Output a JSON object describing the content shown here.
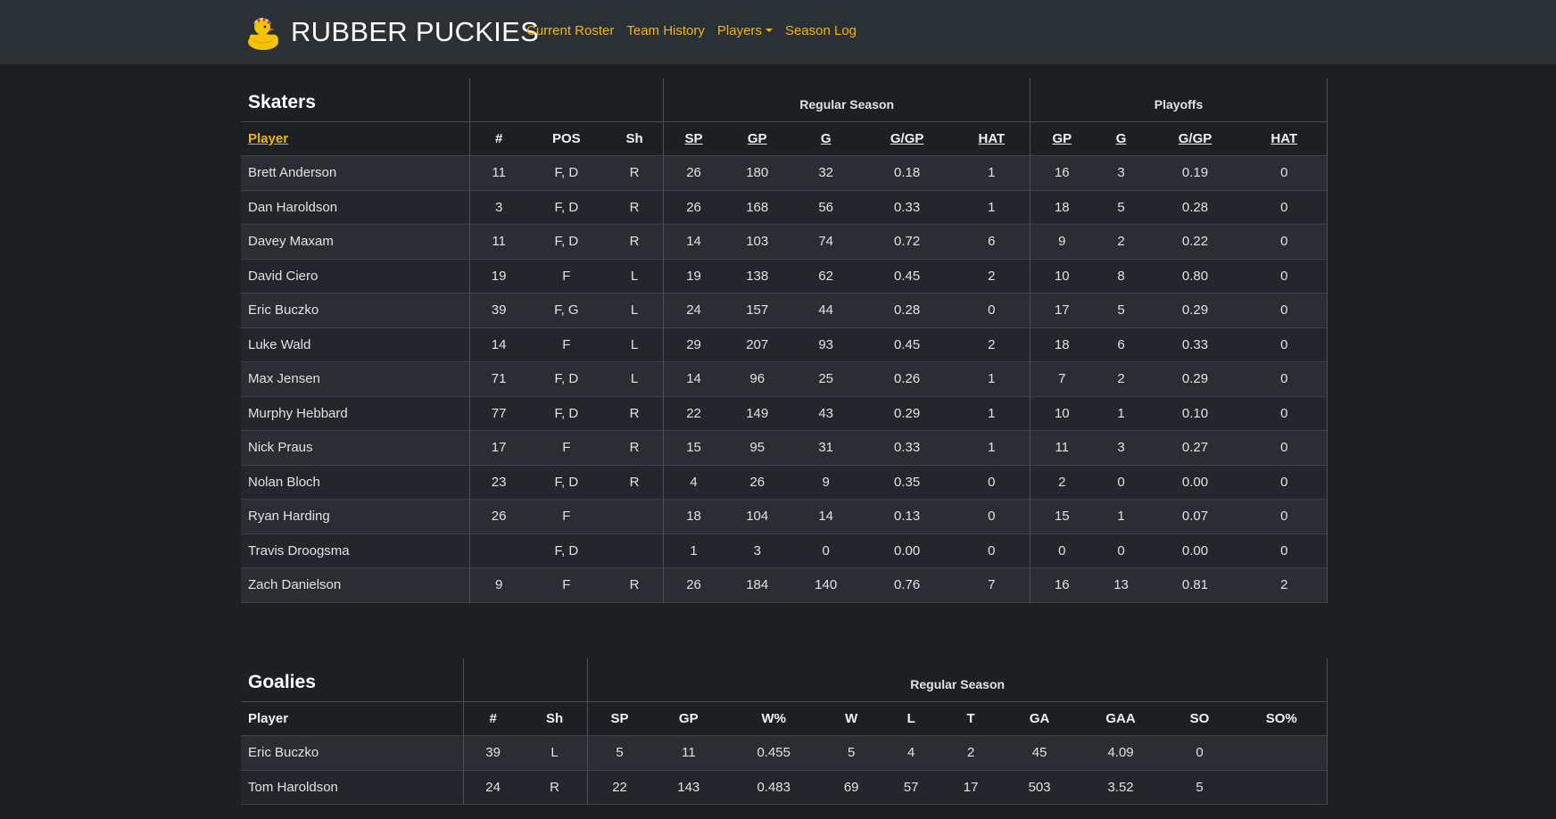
{
  "nav": {
    "brand": "RUBBER PUCKIES",
    "links": [
      "Current Roster",
      "Team History",
      "Players",
      "Season Log"
    ]
  },
  "skaters": {
    "title": "Skaters",
    "group_regular": "Regular Season",
    "group_playoffs": "Playoffs",
    "headers": [
      "Player",
      "#",
      "POS",
      "Sh",
      "SP",
      "GP",
      "G",
      "G/GP",
      "HAT",
      "GP",
      "G",
      "G/GP",
      "HAT"
    ],
    "rows": [
      [
        "Brett Anderson",
        "11",
        "F, D",
        "R",
        "26",
        "180",
        "32",
        "0.18",
        "1",
        "16",
        "3",
        "0.19",
        "0"
      ],
      [
        "Dan Haroldson",
        "3",
        "F, D",
        "R",
        "26",
        "168",
        "56",
        "0.33",
        "1",
        "18",
        "5",
        "0.28",
        "0"
      ],
      [
        "Davey Maxam",
        "11",
        "F, D",
        "R",
        "14",
        "103",
        "74",
        "0.72",
        "6",
        "9",
        "2",
        "0.22",
        "0"
      ],
      [
        "David Ciero",
        "19",
        "F",
        "L",
        "19",
        "138",
        "62",
        "0.45",
        "2",
        "10",
        "8",
        "0.80",
        "0"
      ],
      [
        "Eric Buczko",
        "39",
        "F, G",
        "L",
        "24",
        "157",
        "44",
        "0.28",
        "0",
        "17",
        "5",
        "0.29",
        "0"
      ],
      [
        "Luke Wald",
        "14",
        "F",
        "L",
        "29",
        "207",
        "93",
        "0.45",
        "2",
        "18",
        "6",
        "0.33",
        "0"
      ],
      [
        "Max Jensen",
        "71",
        "F, D",
        "L",
        "14",
        "96",
        "25",
        "0.26",
        "1",
        "7",
        "2",
        "0.29",
        "0"
      ],
      [
        "Murphy Hebbard",
        "77",
        "F, D",
        "R",
        "22",
        "149",
        "43",
        "0.29",
        "1",
        "10",
        "1",
        "0.10",
        "0"
      ],
      [
        "Nick Praus",
        "17",
        "F",
        "R",
        "15",
        "95",
        "31",
        "0.33",
        "1",
        "11",
        "3",
        "0.27",
        "0"
      ],
      [
        "Nolan Bloch",
        "23",
        "F, D",
        "R",
        "4",
        "26",
        "9",
        "0.35",
        "0",
        "2",
        "0",
        "0.00",
        "0"
      ],
      [
        "Ryan Harding",
        "26",
        "F",
        "",
        "18",
        "104",
        "14",
        "0.13",
        "0",
        "15",
        "1",
        "0.07",
        "0"
      ],
      [
        "Travis Droogsma",
        "",
        "F, D",
        "",
        "1",
        "3",
        "0",
        "0.00",
        "0",
        "0",
        "0",
        "0.00",
        "0"
      ],
      [
        "Zach Danielson",
        "9",
        "F",
        "R",
        "26",
        "184",
        "140",
        "0.76",
        "7",
        "16",
        "13",
        "0.81",
        "2"
      ]
    ]
  },
  "goalies": {
    "title": "Goalies",
    "group_regular": "Regular Season",
    "headers": [
      "Player",
      "#",
      "Sh",
      "SP",
      "GP",
      "W%",
      "W",
      "L",
      "T",
      "GA",
      "GAA",
      "SO",
      "SO%"
    ],
    "rows": [
      [
        "Eric Buczko",
        "39",
        "L",
        "5",
        "11",
        "0.455",
        "5",
        "4",
        "2",
        "45",
        "4.09",
        "0",
        ""
      ],
      [
        "Tom Haroldson",
        "24",
        "R",
        "22",
        "143",
        "0.483",
        "69",
        "57",
        "17",
        "503",
        "3.52",
        "5",
        ""
      ]
    ]
  },
  "colors": {
    "accent": "#f2b705",
    "navbar": "#2b3035",
    "background": "#1d2023"
  }
}
